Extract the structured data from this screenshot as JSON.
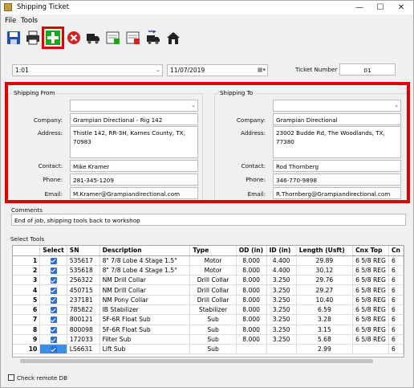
{
  "window": {
    "title": "Shipping Ticket",
    "minimize": "—",
    "maximize": "☐",
    "close": "✕"
  },
  "menu": [
    "File",
    "Tools"
  ],
  "header": {
    "job_value": "1:01",
    "date_value": "11/07/2019",
    "ticket_label": "Ticket Number",
    "ticket_value": "01"
  },
  "shipping_from": {
    "title": "Shipping From",
    "company_label": "Company:",
    "company": "Grampian Directional - Rig 142",
    "address_label": "Address:",
    "address": "Thistle 142, RR-3H, Karnes County, TX, 70983",
    "contact_label": "Contact:",
    "contact": "Mike Kramer",
    "phone_label": "Phone:",
    "phone": "281-345-1209",
    "email_label": "Email:",
    "email": "M.Kramer@Grampiandirectional.com"
  },
  "shipping_to": {
    "title": "Shipping To",
    "company_label": "Company:",
    "company": "Grampian Directional",
    "address_label": "Address:",
    "address": "23002 Budde Rd, The Woodlands, TX, 77380",
    "contact_label": "Contact:",
    "contact": "Rod Thornberg",
    "phone_label": "Phone:",
    "phone": "346-770-9898",
    "email_label": "Email:",
    "email": "R.Thornberg@Grampiandirectional.com"
  },
  "comments": {
    "label": "Comments",
    "value": "End of job, shipping tools back to workshop"
  },
  "tools": {
    "label": "Select Tools",
    "columns": [
      "",
      "Select",
      "SN",
      "Description",
      "Type",
      "OD (in)",
      "ID (in)",
      "Length (Usft)",
      "Cnx Top",
      "Cn"
    ],
    "rows": [
      [
        "1",
        "535617",
        "8\" 7/8 Lobe 4 Stage 1.5°",
        "Motor",
        "8.000",
        "4.400",
        "29.89",
        "6 5/8 REG",
        "6"
      ],
      [
        "2",
        "535618",
        "8\" 7/8 Lobe 4 Stage 1.5°",
        "Motor",
        "8.000",
        "4.400",
        "30.12",
        "6 5/8 REG",
        "6"
      ],
      [
        "3",
        "256322",
        "NM Drill Collar",
        "Drill Collar",
        "8.000",
        "3.250",
        "29.76",
        "6 5/8 REG",
        "6"
      ],
      [
        "4",
        "450715",
        "NM Drill Collar",
        "Drill Collar",
        "8.000",
        "3.250",
        "29.27",
        "6 5/8 REG",
        "6"
      ],
      [
        "5",
        "237181",
        "NM Pony Collar",
        "Drill Collar",
        "8.000",
        "3.250",
        "10.40",
        "6 5/8 REG",
        "6"
      ],
      [
        "6",
        "785822",
        "IB Stabilizer",
        "Stabilizer",
        "8.000",
        "3.250",
        "6.59",
        "6 5/8 REG",
        "6"
      ],
      [
        "7",
        "800121",
        "5F-6R Float Sub",
        "Sub",
        "8.000",
        "3.250",
        "3.28",
        "6 5/8 REG",
        "6"
      ],
      [
        "8",
        "800098",
        "5F-6R Float Sub",
        "Sub",
        "8.000",
        "3.250",
        "3.15",
        "6 5/8 REG",
        "6"
      ],
      [
        "9",
        "172033",
        "Filter Sub",
        "Sub",
        "8.000",
        "3.250",
        "5.68",
        "6 5/8 REG",
        "6"
      ],
      [
        "10",
        "LS6631",
        "Lift Sub",
        "Sub",
        "",
        "",
        "2.99",
        "",
        "6"
      ]
    ]
  },
  "footer": {
    "remote_db_label": "Check remote DB"
  },
  "icons": [
    "save-icon",
    "print-icon",
    "add-icon",
    "cancel-icon",
    "truck-icon",
    "add-sheet-icon",
    "remove-sheet-icon",
    "transfer-truck-icon",
    "home-icon"
  ]
}
